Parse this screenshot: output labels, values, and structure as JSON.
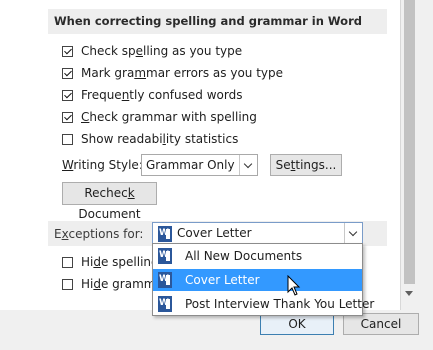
{
  "section_title": "When correcting spelling and grammar in Word",
  "checkboxes": [
    {
      "label_pre": "Check sp",
      "label_u": "e",
      "label_post": "lling as you type",
      "checked": true
    },
    {
      "label_pre": "Mark gra",
      "label_u": "m",
      "label_post": "mar errors as you type",
      "checked": true
    },
    {
      "label_pre": "Freque",
      "label_u": "n",
      "label_post": "tly confused words",
      "checked": true
    },
    {
      "label_pre": "",
      "label_u": "C",
      "label_post": "heck grammar with spelling",
      "checked": true
    },
    {
      "label_pre": "Show readabi",
      "label_u": "l",
      "label_post": "ity statistics",
      "checked": false
    }
  ],
  "writing_style": {
    "label_u": "W",
    "label_post": "riting Style:",
    "value": "Grammar Only"
  },
  "settings_button": {
    "pre": "Se",
    "u": "t",
    "post": "tings..."
  },
  "recheck_button": {
    "pre": "Rechec",
    "u": "k",
    "post": " Document"
  },
  "exceptions": {
    "label_pre": "E",
    "label_u": "x",
    "label_post": "ceptions for:",
    "selected": "Cover Letter"
  },
  "exception_checkboxes": [
    {
      "label_pre": "Hi",
      "label_u": "d",
      "label_post": "e spelling",
      "checked": false
    },
    {
      "label_pre": "Hi",
      "label_u": "d",
      "label_post": "e gramma",
      "checked": false
    }
  ],
  "dropdown_options": [
    {
      "label": "All New Documents",
      "selected": false
    },
    {
      "label": "Cover Letter",
      "selected": true
    },
    {
      "label": "Post Interview Thank You Letter",
      "selected": false
    }
  ],
  "footer": {
    "ok_label": "OK",
    "cancel_label": "Cancel"
  },
  "colors": {
    "selection": "#3399ff",
    "primary_button_border": "#3c7fb1"
  }
}
